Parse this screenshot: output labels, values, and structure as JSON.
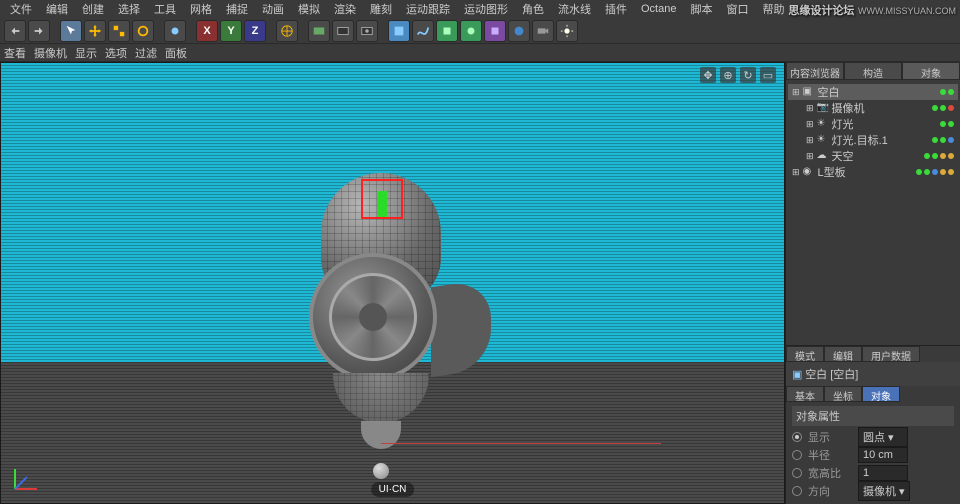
{
  "watermark": {
    "title": "思缘设计论坛",
    "url": "WWW.MISSYUAN.COM"
  },
  "menu": [
    "文件",
    "编辑",
    "创建",
    "选择",
    "工具",
    "网格",
    "捕捉",
    "动画",
    "模拟",
    "渲染",
    "雕刻",
    "运动跟踪",
    "运动图形",
    "角色",
    "流水线",
    "插件",
    "Octane",
    "脚本",
    "窗口",
    "帮助"
  ],
  "subbar": [
    "查看",
    "摄像机",
    "显示",
    "选项",
    "过滤",
    "面板"
  ],
  "panel_tabs": [
    "内容浏览器",
    "构造",
    "对象"
  ],
  "tree": [
    {
      "icon": "null",
      "label": "空白",
      "sel": true,
      "dots": [
        "g",
        "g"
      ]
    },
    {
      "icon": "cam",
      "label": "摄像机",
      "indent": 1,
      "dots": [
        "g",
        "g",
        "r"
      ]
    },
    {
      "icon": "light",
      "label": "灯光",
      "indent": 1,
      "dots": [
        "g",
        "g"
      ]
    },
    {
      "icon": "light",
      "label": "灯光.目标.1",
      "indent": 1,
      "dots": [
        "g",
        "g",
        "b"
      ]
    },
    {
      "icon": "sky",
      "label": "天空",
      "indent": 1,
      "dots": [
        "g",
        "g",
        "o",
        "o"
      ]
    },
    {
      "icon": "obj",
      "label": "L型板",
      "dots": [
        "g",
        "g",
        "b",
        "o",
        "o"
      ]
    }
  ],
  "attr": {
    "tabs": [
      "模式",
      "编辑",
      "用户数据"
    ],
    "title": "空白 [空白]",
    "subtabs": [
      "基本",
      "坐标",
      "对象"
    ],
    "section": "对象属性",
    "rows": [
      {
        "label": "显示",
        "value": "圆点",
        "type": "select",
        "on": true
      },
      {
        "label": "半径",
        "value": "10 cm",
        "type": "num"
      },
      {
        "label": "宽高比",
        "value": "1",
        "type": "num"
      },
      {
        "label": "方向",
        "value": "摄像机",
        "type": "select"
      }
    ]
  },
  "logo": "UI·CN"
}
